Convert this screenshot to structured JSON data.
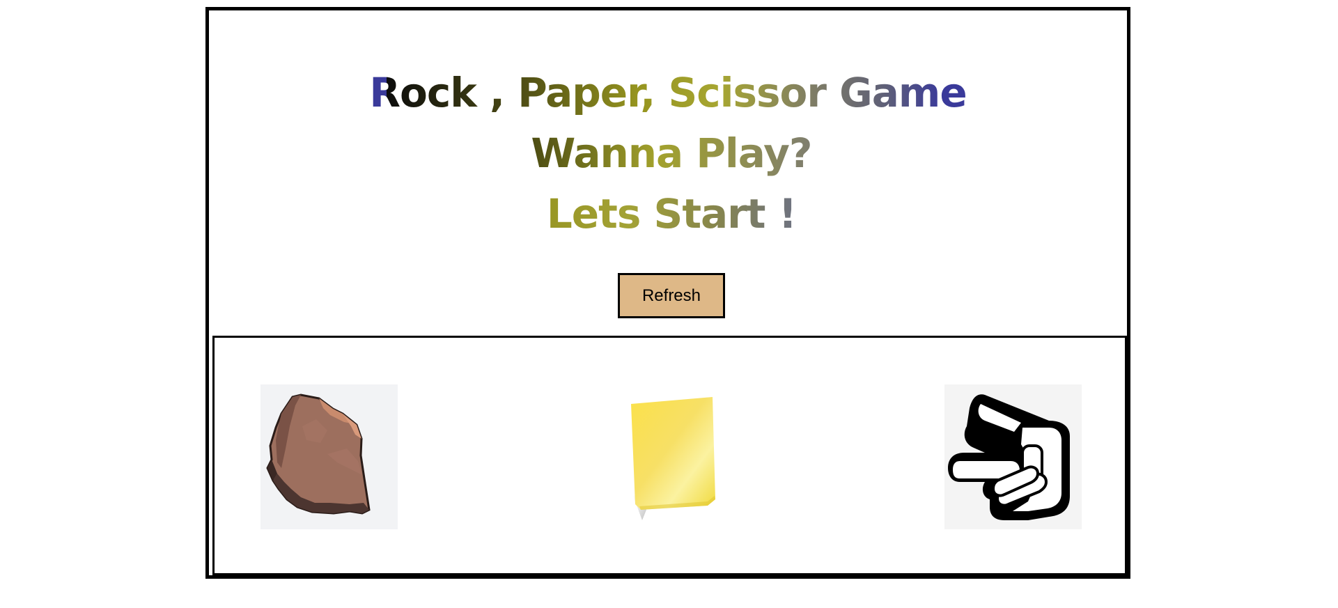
{
  "game": {
    "title": "Rock , Paper, Scissor Game",
    "subtitle": "Wanna Play?",
    "prompt": "Lets Start !",
    "refresh_label": "Refresh"
  },
  "choices": [
    {
      "name": "rock",
      "icon": "rock-icon"
    },
    {
      "name": "paper",
      "icon": "sticky-paper-icon"
    },
    {
      "name": "scissor",
      "icon": "scissor-hand-icon"
    }
  ],
  "colors": {
    "frame_border": "#000000",
    "button_background": "#deb887",
    "title_gradient": [
      "#0c0c0c",
      "#4b4a14",
      "#95941f",
      "#7f7d65",
      "#3a3a9a"
    ]
  }
}
